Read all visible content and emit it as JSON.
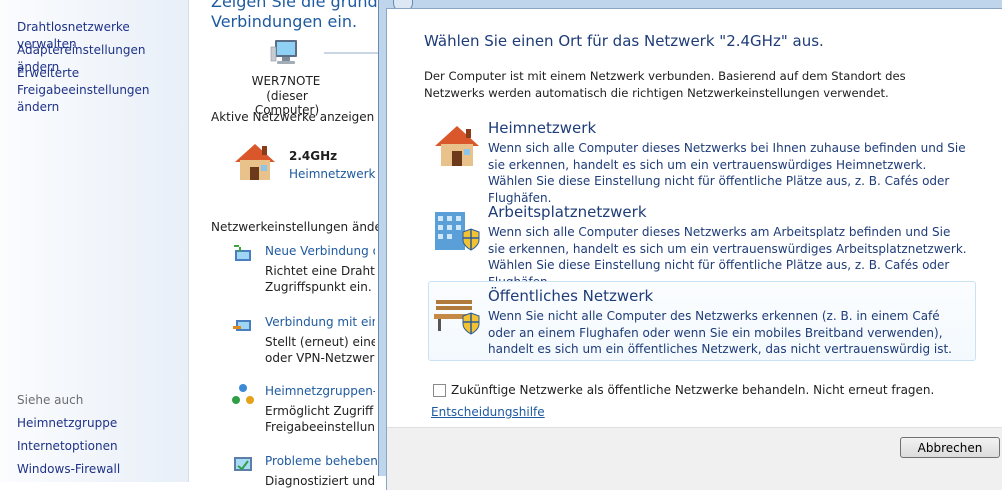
{
  "sidebar": {
    "links": [
      "Drahtlosnetzwerke verwalten",
      "Adaptereinstellungen ändern",
      "Erweiterte Freigabeeinstellungen ändern"
    ],
    "see_also_label": "Siehe auch",
    "see_also": [
      "Heimnetzgruppe",
      "Internetoptionen",
      "Windows-Firewall"
    ]
  },
  "main": {
    "title_line1": "Zeigen Sie die grundleg",
    "title_line2": "Verbindungen ein.",
    "computer_name": "WER7NOTE",
    "computer_sub": "(dieser Computer)",
    "active_networks_label": "Aktive Netzwerke anzeigen",
    "network_name": "2.4GHz",
    "network_type": "Heimnetzwerk",
    "settings_label": "Netzwerkeinstellungen ändern",
    "tasks": [
      {
        "title": "Neue Verbindung ode",
        "desc1": "Richtet eine Drahtlos-",
        "desc2": "Zugriffspunkt ein."
      },
      {
        "title": "Verbindung mit einer",
        "desc1": "Stellt (erneut) eine Ve",
        "desc2": "oder VPN-Netzwerk h"
      },
      {
        "title": "Heimnetzgruppen- u",
        "desc1": "Ermöglicht Zugriff au",
        "desc2": "Freigabeeinstellunger"
      },
      {
        "title": "Probleme beheben",
        "desc1": "Diagnostiziert und behebt Netzwerkprobleme, oder ruft Problembehandlungsinformationen ab.",
        "desc2": ""
      }
    ]
  },
  "dialog": {
    "heading": "Wählen Sie einen Ort für das Netzwerk \"2.4GHz\" aus.",
    "intro": "Der Computer ist mit einem Netzwerk verbunden. Basierend auf dem Standort des Netzwerks werden automatisch die richtigen Netzwerkeinstellungen verwendet.",
    "options": [
      {
        "title": "Heimnetzwerk",
        "desc": "Wenn sich alle Computer dieses Netzwerks bei Ihnen zuhause befinden und Sie sie erkennen, handelt es sich um ein vertrauenswürdiges Heimnetzwerk. Wählen Sie diese Einstellung nicht für öffentliche Plätze aus, z. B. Cafés oder Flughäfen.",
        "icon": "house-icon"
      },
      {
        "title": "Arbeitsplatznetzwerk",
        "desc": "Wenn sich alle Computer dieses Netzwerks am Arbeitsplatz befinden und Sie sie erkennen, handelt es sich um ein vertrauenswürdiges Arbeitsplatznetzwerk. Wählen Sie diese Einstellung nicht für öffentliche Plätze aus, z. B. Cafés oder Flughäfen.",
        "icon": "office-building-icon"
      },
      {
        "title": "Öffentliches Netzwerk",
        "desc": "Wenn Sie nicht alle Computer des Netzwerks erkennen (z. B. in einem Café oder an einem Flughafen oder wenn Sie ein mobiles Breitband verwenden), handelt es sich um ein öffentliches Netzwerk, das nicht vertrauenswürdig ist.",
        "icon": "park-bench-icon"
      }
    ],
    "checkbox_label": "Zukünftige Netzwerke als öffentliche Netzwerke behandeln. Nicht erneut fragen.",
    "help_link": "Entscheidungshilfe",
    "cancel_button": "Abbrechen"
  }
}
